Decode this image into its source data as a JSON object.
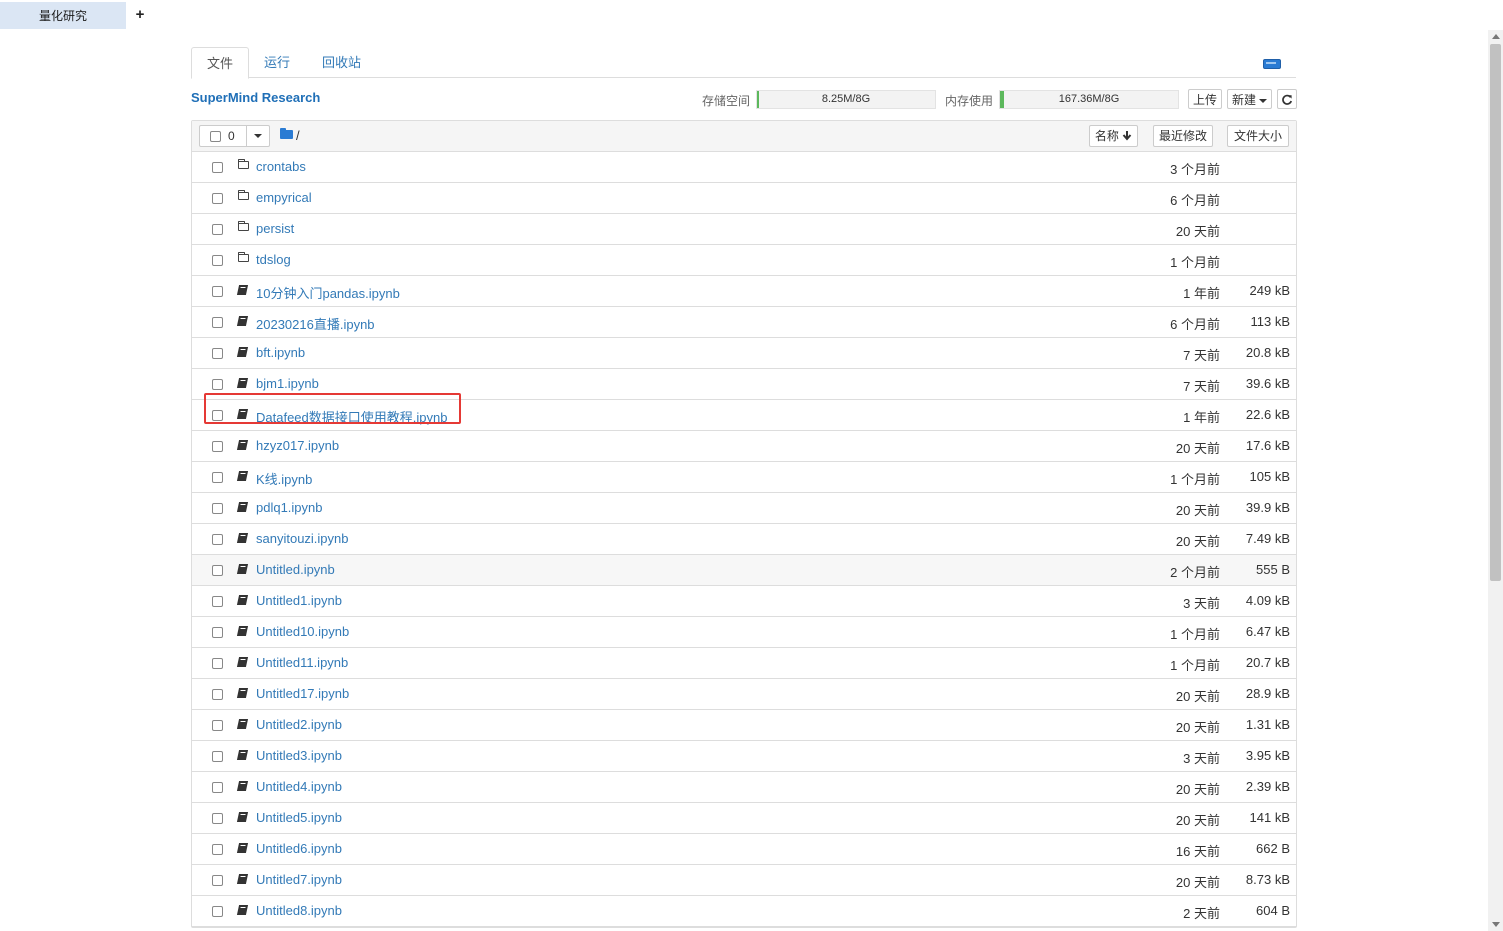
{
  "app_tab": {
    "label": "量化研究",
    "new_tab": "+"
  },
  "tabs": [
    "文件",
    "运行",
    "回收站"
  ],
  "header": {
    "brand": "SuperMind Research",
    "storage_label": "存储空间",
    "storage_value": "8.25M/8G",
    "storage_fraction": 0.001,
    "memory_label": "内存使用",
    "memory_value": "167.36M/8G",
    "memory_fraction": 0.02,
    "upload": "上传",
    "new": "新建",
    "refresh_icon": "refresh-icon",
    "kernel_icon": "kernel-status-icon"
  },
  "list_header": {
    "selected_count": "0",
    "path": "/",
    "sort_name": "名称",
    "sort_modified": "最近修改",
    "sort_size": "文件大小"
  },
  "files": [
    {
      "type": "folder",
      "name": "crontabs",
      "modified": "3 个月前",
      "size": ""
    },
    {
      "type": "folder",
      "name": "empyrical",
      "modified": "6 个月前",
      "size": ""
    },
    {
      "type": "folder",
      "name": "persist",
      "modified": "20 天前",
      "size": ""
    },
    {
      "type": "folder",
      "name": "tdslog",
      "modified": "1 个月前",
      "size": ""
    },
    {
      "type": "notebook",
      "name": "10分钟入门pandas.ipynb",
      "modified": "1 年前",
      "size": "249 kB"
    },
    {
      "type": "notebook",
      "name": "20230216直播.ipynb",
      "modified": "6 个月前",
      "size": "113 kB"
    },
    {
      "type": "notebook",
      "name": "bft.ipynb",
      "modified": "7 天前",
      "size": "20.8 kB"
    },
    {
      "type": "notebook",
      "name": "bjm1.ipynb",
      "modified": "7 天前",
      "size": "39.6 kB"
    },
    {
      "type": "notebook",
      "name": "Datafeed数据接口使用教程.ipynb",
      "modified": "1 年前",
      "size": "22.6 kB"
    },
    {
      "type": "notebook",
      "name": "hzyz017.ipynb",
      "modified": "20 天前",
      "size": "17.6 kB"
    },
    {
      "type": "notebook",
      "name": "K线.ipynb",
      "modified": "1 个月前",
      "size": "105 kB"
    },
    {
      "type": "notebook",
      "name": "pdlq1.ipynb",
      "modified": "20 天前",
      "size": "39.9 kB"
    },
    {
      "type": "notebook",
      "name": "sanyitouzi.ipynb",
      "modified": "20 天前",
      "size": "7.49 kB"
    },
    {
      "type": "notebook",
      "name": "Untitled.ipynb",
      "modified": "2 个月前",
      "size": "555 B"
    },
    {
      "type": "notebook",
      "name": "Untitled1.ipynb",
      "modified": "3 天前",
      "size": "4.09 kB"
    },
    {
      "type": "notebook",
      "name": "Untitled10.ipynb",
      "modified": "1 个月前",
      "size": "6.47 kB"
    },
    {
      "type": "notebook",
      "name": "Untitled11.ipynb",
      "modified": "1 个月前",
      "size": "20.7 kB"
    },
    {
      "type": "notebook",
      "name": "Untitled17.ipynb",
      "modified": "20 天前",
      "size": "28.9 kB"
    },
    {
      "type": "notebook",
      "name": "Untitled2.ipynb",
      "modified": "20 天前",
      "size": "1.31 kB"
    },
    {
      "type": "notebook",
      "name": "Untitled3.ipynb",
      "modified": "3 天前",
      "size": "3.95 kB"
    },
    {
      "type": "notebook",
      "name": "Untitled4.ipynb",
      "modified": "20 天前",
      "size": "2.39 kB"
    },
    {
      "type": "notebook",
      "name": "Untitled5.ipynb",
      "modified": "20 天前",
      "size": "141 kB"
    },
    {
      "type": "notebook",
      "name": "Untitled6.ipynb",
      "modified": "16 天前",
      "size": "662 B"
    },
    {
      "type": "notebook",
      "name": "Untitled7.ipynb",
      "modified": "20 天前",
      "size": "8.73 kB"
    },
    {
      "type": "notebook",
      "name": "Untitled8.ipynb",
      "modified": "2 天前",
      "size": "604 B"
    }
  ],
  "colors": {
    "link": "#337ab7",
    "brand": "#1f6fb7",
    "highlight": "#e53935",
    "meter_fill": "#5cb85c"
  }
}
